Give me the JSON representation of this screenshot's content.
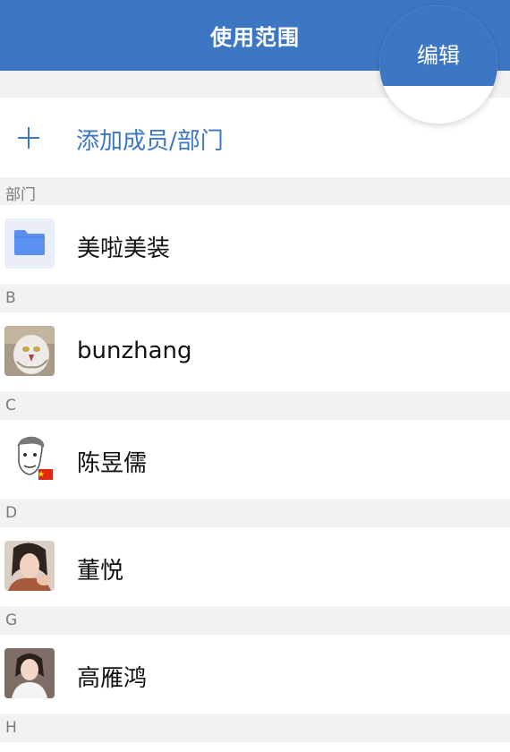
{
  "header": {
    "title": "使用范围",
    "edit_label": "编辑"
  },
  "add_member": {
    "label": "添加成员/部门"
  },
  "sections": {
    "dept": {
      "header": "部门",
      "item": "美啦美装"
    },
    "b": {
      "header": "B",
      "item": "bunzhang"
    },
    "c": {
      "header": "C",
      "item": "陈昱儒"
    },
    "d": {
      "header": "D",
      "item": "董悦"
    },
    "g": {
      "header": "G",
      "item": "高雁鸿"
    },
    "h": {
      "header": "H"
    }
  },
  "colors": {
    "accent": "#3d77c3",
    "section_bg": "#f2f2f2",
    "folder": "#5b8ff0"
  },
  "icons": {
    "add": "plus-icon",
    "department": "folder-icon",
    "flag": "china-flag-icon"
  }
}
